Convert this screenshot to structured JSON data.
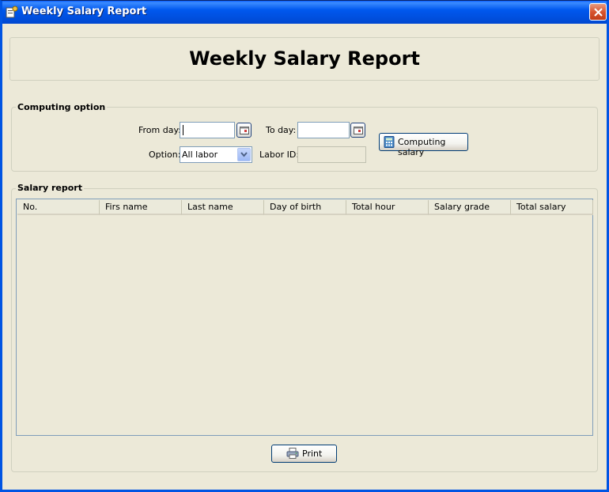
{
  "window": {
    "title": "Weekly Salary Report",
    "icon": "app-icon",
    "close_icon": "close-icon"
  },
  "header": {
    "title": "Weekly Salary Report"
  },
  "computing_option": {
    "legend": "Computing option",
    "from_day_label": "From day:",
    "from_day_value": "",
    "to_day_label": "To day:",
    "to_day_value": "",
    "option_label": "Option:",
    "option_value": "All labor",
    "labor_id_label": "Labor ID:",
    "labor_id_value": "",
    "compute_button": "Computing salary",
    "calendar_icon": "calendar-icon",
    "compute_icon": "calculator-icon"
  },
  "salary_report": {
    "legend": "Salary report",
    "columns": [
      "No.",
      "Firs name",
      "Last name",
      "Day of birth",
      "Total hour",
      "Salary grade",
      "Total salary"
    ],
    "rows": []
  },
  "footer": {
    "print_button": "Print",
    "print_icon": "printer-icon"
  },
  "colors": {
    "window_bg": "#ece9d8",
    "titlebar": "#0054e3",
    "close_button": "#d8542f",
    "input_border": "#7f9db9"
  }
}
